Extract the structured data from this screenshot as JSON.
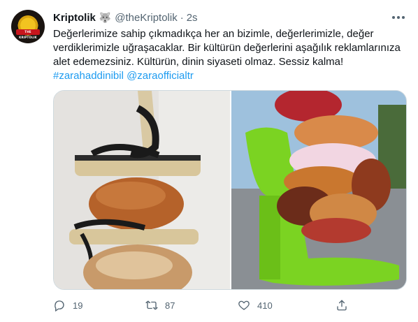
{
  "tweet": {
    "display_name": "Kriptolik",
    "badge_emoji": "🐺",
    "handle": "@theKriptolik",
    "separator": "·",
    "time": "2s",
    "more_icon": "more-horizontal-icon",
    "avatar_text": "THE KRIPTOLIK",
    "text_lines": [
      "Değerlerimize sahip çıkmadıkça her an bizimle, değerlerimizle, değer",
      "verdiklerimizle uğraşacaklar. Bir kültürün değerlerini aşağılık reklamlarınıza",
      "alet edemezsiniz. Kültürün, dinin siyaseti olmaz. Sessiz kalma!"
    ],
    "hashtag": "#zarahaddinibil",
    "mention": "@zaraofficialtr",
    "media": [
      {
        "name": "stacked-bread-and-sandals-photo"
      },
      {
        "name": "green-heel-with-donuts-photo"
      }
    ]
  },
  "actions": {
    "reply": {
      "icon": "reply-icon",
      "count": "19"
    },
    "retweet": {
      "icon": "retweet-icon",
      "count": "87"
    },
    "like": {
      "icon": "like-icon",
      "count": "410"
    },
    "share": {
      "icon": "share-icon"
    }
  },
  "colors": {
    "text": "#0f1419",
    "secondary": "#536471",
    "link": "#1d9bf0",
    "border": "#cfd9de"
  }
}
